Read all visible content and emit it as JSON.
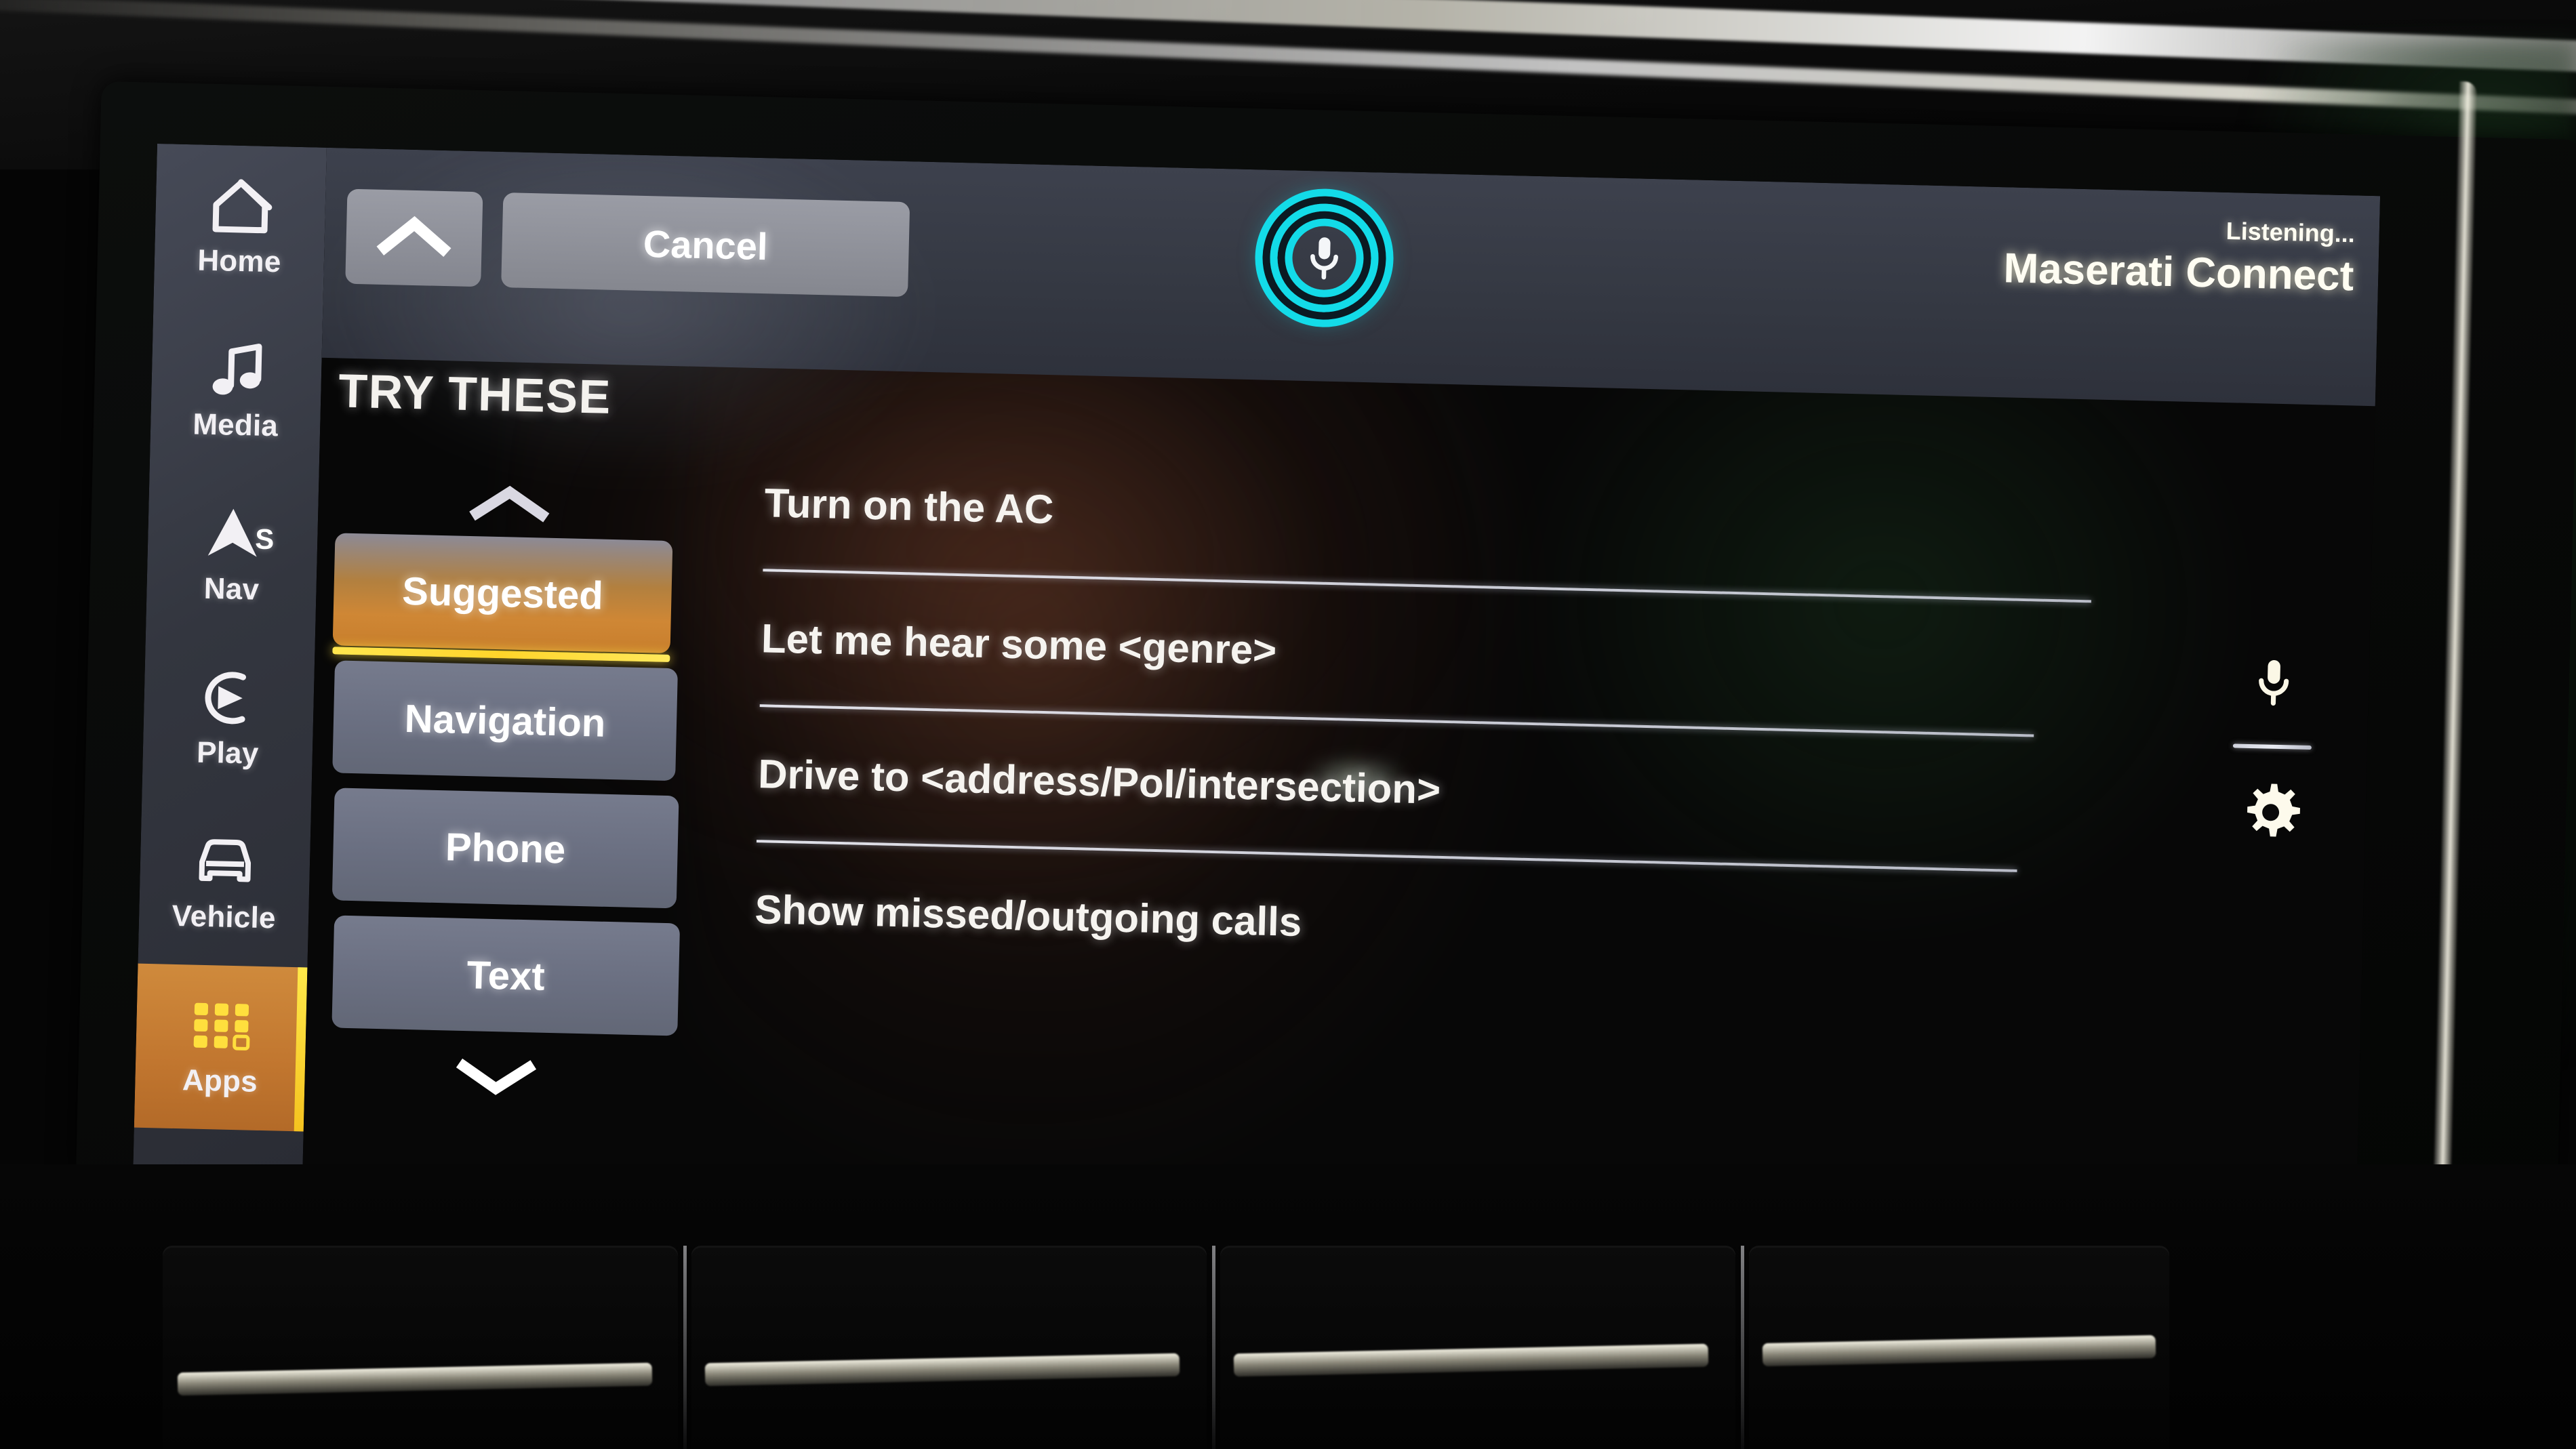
{
  "device": {
    "name": "maserati-infotainment-touchscreen"
  },
  "sidebar": {
    "items": [
      {
        "label": "Home",
        "icon": "home-icon",
        "active": false,
        "badge": ""
      },
      {
        "label": "Media",
        "icon": "music-note-icon",
        "active": false,
        "badge": ""
      },
      {
        "label": "Nav",
        "icon": "navigation-arrow-icon",
        "active": false,
        "badge": "S"
      },
      {
        "label": "Play",
        "icon": "carplay-icon",
        "active": false,
        "badge": ""
      },
      {
        "label": "Vehicle",
        "icon": "car-front-icon",
        "active": false,
        "badge": ""
      },
      {
        "label": "Apps",
        "icon": "apps-grid-icon",
        "active": true,
        "badge": ""
      }
    ]
  },
  "topbar": {
    "back_icon": "chevron-up-icon",
    "cancel_label": "Cancel",
    "mic_icon": "microphone-listening-icon",
    "status_line1": "Listening...",
    "status_line2": "Maserati Connect"
  },
  "main": {
    "heading": "TRY THESE",
    "scroll_up_icon": "chevron-up-icon",
    "scroll_down_icon": "chevron-down-icon",
    "categories": [
      {
        "label": "Suggested",
        "selected": true
      },
      {
        "label": "Navigation",
        "selected": false
      },
      {
        "label": "Phone",
        "selected": false
      },
      {
        "label": "Text",
        "selected": false
      }
    ],
    "suggestions": [
      "Turn on the AC",
      "Let me hear some <genre>",
      "Drive to <address/PoI/intersection>",
      "Show missed/outgoing calls"
    ]
  },
  "right_rail": {
    "mic_icon": "microphone-icon",
    "settings_icon": "gear-icon"
  },
  "colors": {
    "accent_orange": "#cf8735",
    "accent_yellow": "#ffe14a",
    "listening_cyan": "#13dbe8",
    "topbar_gray": "#3d414d",
    "button_gray": "#9a9ca5",
    "category_gray": "#6a6f81",
    "screen_black": "#070707"
  }
}
